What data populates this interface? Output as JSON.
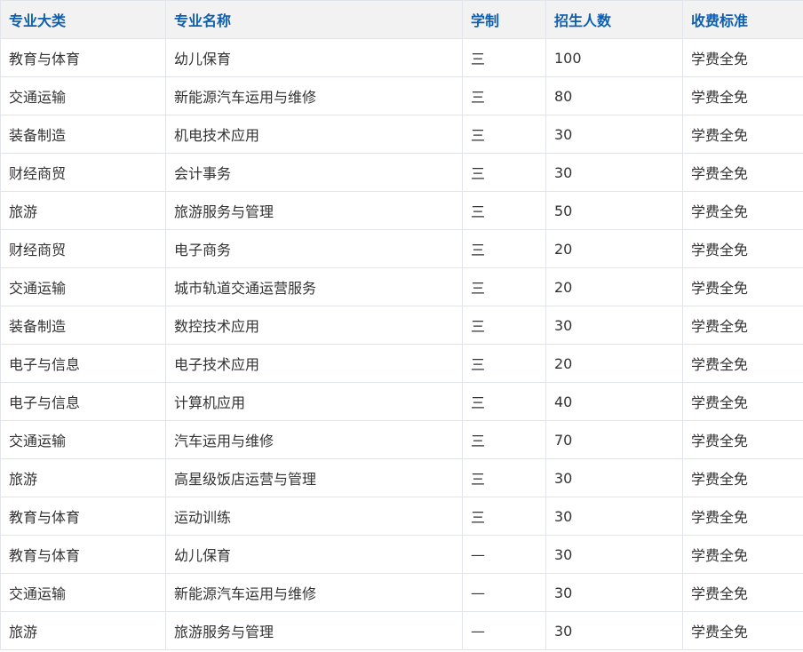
{
  "table": {
    "headers": [
      "专业大类",
      "专业名称",
      "学制",
      "招生人数",
      "收费标准"
    ],
    "rows": [
      [
        "教育与体育",
        "幼儿保育",
        "三",
        "100",
        "学费全免"
      ],
      [
        "交通运输",
        "新能源汽车运用与维修",
        "三",
        "80",
        "学费全免"
      ],
      [
        "装备制造",
        "机电技术应用",
        "三",
        "30",
        "学费全免"
      ],
      [
        "财经商贸",
        "会计事务",
        "三",
        "30",
        "学费全免"
      ],
      [
        "旅游",
        "旅游服务与管理",
        "三",
        "50",
        "学费全免"
      ],
      [
        "财经商贸",
        "电子商务",
        "三",
        "20",
        "学费全免"
      ],
      [
        "交通运输",
        "城市轨道交通运营服务",
        "三",
        "20",
        "学费全免"
      ],
      [
        "装备制造",
        "数控技术应用",
        "三",
        "30",
        "学费全免"
      ],
      [
        "电子与信息",
        "电子技术应用",
        "三",
        "20",
        "学费全免"
      ],
      [
        "电子与信息",
        "计算机应用",
        "三",
        "40",
        "学费全免"
      ],
      [
        "交通运输",
        "汽车运用与维修",
        "三",
        "70",
        "学费全免"
      ],
      [
        "旅游",
        "高星级饭店运营与管理",
        "三",
        "30",
        "学费全免"
      ],
      [
        "教育与体育",
        "运动训练",
        "三",
        "30",
        "学费全免"
      ],
      [
        "教育与体育",
        "幼儿保育",
        "—",
        "30",
        "学费全免"
      ],
      [
        "交通运输",
        "新能源汽车运用与维修",
        "—",
        "30",
        "学费全免"
      ],
      [
        "旅游",
        "旅游服务与管理",
        "—",
        "30",
        "学费全免"
      ]
    ]
  },
  "colors": {
    "header_text": "#0e5fb0",
    "header_bg": "#f2f2f2",
    "cell_text": "#333333",
    "border": "#e1e4e8"
  }
}
